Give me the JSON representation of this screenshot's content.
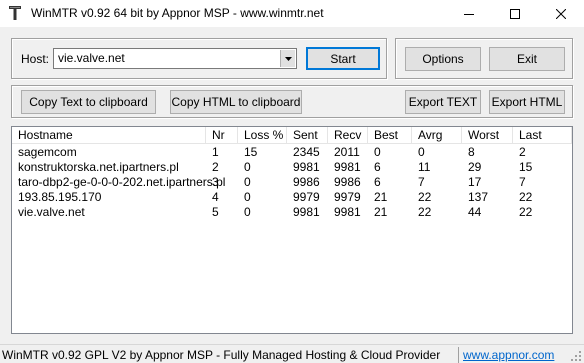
{
  "window": {
    "title": "WinMTR v0.92 64 bit by Appnor MSP - www.winmtr.net"
  },
  "host": {
    "label": "Host:",
    "value": "vie.valve.net"
  },
  "buttons": {
    "start": "Start",
    "options": "Options",
    "exit": "Exit",
    "copy_text": "Copy Text to clipboard",
    "copy_html": "Copy HTML to clipboard",
    "export_text": "Export TEXT",
    "export_html": "Export HTML"
  },
  "table": {
    "columns": [
      "Hostname",
      "Nr",
      "Loss %",
      "Sent",
      "Recv",
      "Best",
      "Avrg",
      "Worst",
      "Last"
    ],
    "rows": [
      [
        "sagemcom",
        "1",
        "15",
        "2345",
        "2011",
        "0",
        "0",
        "8",
        "2"
      ],
      [
        "konstruktorska.net.ipartners.pl",
        "2",
        "0",
        "9981",
        "9981",
        "6",
        "11",
        "29",
        "15"
      ],
      [
        "taro-dbp2-ge-0-0-0-202.net.ipartners.pl",
        "3",
        "0",
        "9986",
        "9986",
        "6",
        "7",
        "17",
        "7"
      ],
      [
        "193.85.195.170",
        "4",
        "0",
        "9979",
        "9979",
        "21",
        "22",
        "137",
        "22"
      ],
      [
        "vie.valve.net",
        "5",
        "0",
        "9981",
        "9981",
        "21",
        "22",
        "44",
        "22"
      ]
    ]
  },
  "status": {
    "text": "WinMTR v0.92 GPL V2 by Appnor MSP - Fully Managed Hosting & Cloud Provider",
    "link": "www.appnor.com"
  },
  "icons": [
    "app-icon",
    "minimize-icon",
    "maximize-icon",
    "close-icon",
    "dropdown-arrow-icon",
    "size-grip-icon"
  ]
}
